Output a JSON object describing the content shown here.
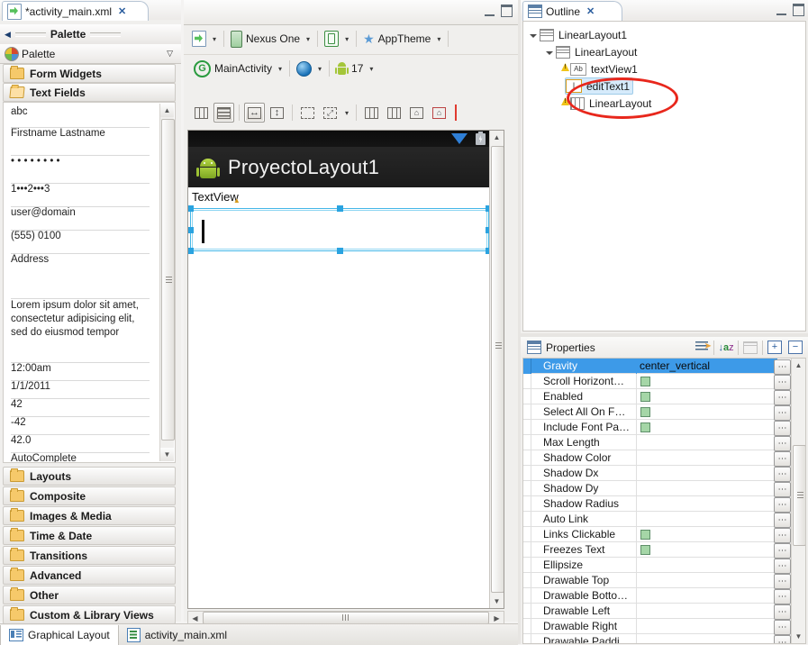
{
  "editor": {
    "tab_title": "*activity_main.xml",
    "close_glyph": "✕",
    "toolbar_row1": [
      {
        "label": "",
        "icon": "xml-config-icon",
        "caret": "▾"
      },
      {
        "label": "Nexus One",
        "icon": "device-icon",
        "caret": "▾"
      },
      {
        "label": "",
        "icon": "orientation-icon",
        "caret": "▾"
      },
      {
        "label": "AppTheme",
        "icon": "theme-star-icon",
        "caret": "▾"
      }
    ],
    "toolbar_row2": [
      {
        "label": "MainActivity",
        "icon": "activity-icon",
        "caret": "▾"
      },
      {
        "label": "",
        "icon": "locale-globe-icon",
        "caret": "▾"
      },
      {
        "label": "17",
        "icon": "android-api-icon",
        "caret": "▾"
      }
    ],
    "toolbar_row3": [
      {
        "name": "distribute-columns-button",
        "active": false
      },
      {
        "name": "distribute-rows-button",
        "active": true
      },
      {
        "name": "match-width-button",
        "active": true
      },
      {
        "name": "match-height-button",
        "active": false
      },
      {
        "name": "select-marquee-button",
        "active": false
      },
      {
        "name": "expand-all-button",
        "active": false
      },
      {
        "name": "show-included-button",
        "active": false
      },
      {
        "name": "show-outline-button",
        "active": false
      },
      {
        "name": "show-baseline-button",
        "active": false
      },
      {
        "name": "hide-baseline-button",
        "active": false
      }
    ],
    "bottom_tabs": [
      {
        "label": "Graphical Layout",
        "icon": "graphical-layout-icon",
        "active": true
      },
      {
        "label": "activity_main.xml",
        "icon": "xml-source-icon",
        "active": false
      }
    ]
  },
  "canvas": {
    "app_title": "ProyectoLayout1",
    "textview_label": "TextView",
    "status_signal": "signal-icon",
    "status_battery": "battery-icon",
    "selection_handle_color": "#2aa3e0"
  },
  "palette": {
    "header_title": "Palette",
    "strip_label": "Palette",
    "collapse_glyph": "◀",
    "chevron_glyph": "▽",
    "categories_top": [
      {
        "label": "Form Widgets",
        "open": false
      },
      {
        "label": "Text Fields",
        "open": true
      }
    ],
    "items": [
      {
        "label": "abc",
        "height": 27
      },
      {
        "label": "Firstname Lastname",
        "height": 34
      },
      {
        "label": "• • • • • • • •",
        "height": 34
      },
      {
        "label": "1•••2•••3",
        "height": 29
      },
      {
        "label": "user@domain",
        "height": 29
      },
      {
        "label": "(555) 0100",
        "height": 29
      },
      {
        "label": "Address",
        "height": 53
      },
      {
        "label": "Lorem ipsum dolor sit amet, consectetur adipisicing elit, sed do eiusmod tempor",
        "height": 74,
        "multiline": true
      },
      {
        "label": "12:00am",
        "height": 23
      },
      {
        "label": "1/1/2011",
        "height": 23
      },
      {
        "label": "42",
        "height": 23
      },
      {
        "label": "-42",
        "height": 23
      },
      {
        "label": "42.0",
        "height": 23
      },
      {
        "label": "AutoComplete",
        "height": 23
      }
    ],
    "categories_bottom": [
      {
        "label": "Layouts"
      },
      {
        "label": "Composite"
      },
      {
        "label": "Images & Media"
      },
      {
        "label": "Time & Date"
      },
      {
        "label": "Transitions"
      },
      {
        "label": "Advanced"
      },
      {
        "label": "Other"
      },
      {
        "label": "Custom & Library Views"
      }
    ]
  },
  "outline": {
    "tab_title": "Outline",
    "close_glyph": "✕",
    "nodes": [
      {
        "label": "LinearLayout1",
        "indent": 0,
        "icon": "linearlayout-icon",
        "twisty": true,
        "warn": false,
        "selected": false
      },
      {
        "label": "LinearLayout",
        "indent": 1,
        "icon": "linearlayout-icon",
        "twisty": true,
        "warn": false,
        "selected": false
      },
      {
        "label": "textView1",
        "indent": 2,
        "icon": "textview-icon",
        "twisty": false,
        "warn": true,
        "selected": false
      },
      {
        "label": "editText1",
        "indent": 2,
        "icon": "edittext-icon",
        "twisty": false,
        "warn": false,
        "selected": true
      },
      {
        "label": "LinearLayout",
        "indent": 1,
        "icon": "linearlayout-vertical-icon",
        "twisty": false,
        "warn": true,
        "selected": false
      }
    ],
    "annotation": {
      "shape": "red-ellipse",
      "color": "#e8271c"
    }
  },
  "properties": {
    "title": "Properties",
    "tools": [
      {
        "name": "show-advanced-toggle"
      },
      {
        "name": "sort-alphabetically-button"
      },
      {
        "name": "table-view-button"
      },
      {
        "name": "expand-all-button",
        "glyph": "+"
      },
      {
        "name": "collapse-all-button",
        "glyph": "−"
      }
    ],
    "rows": [
      {
        "name": "Gravity",
        "value": "center_vertical",
        "checkbox": false,
        "selected": true
      },
      {
        "name": "Scroll Horizont…",
        "value": "",
        "checkbox": true,
        "selected": false
      },
      {
        "name": "Enabled",
        "value": "",
        "checkbox": true,
        "selected": false
      },
      {
        "name": "Select All On F…",
        "value": "",
        "checkbox": true,
        "selected": false
      },
      {
        "name": "Include Font Pa…",
        "value": "",
        "checkbox": true,
        "selected": false
      },
      {
        "name": "Max Length",
        "value": "",
        "checkbox": false,
        "selected": false
      },
      {
        "name": "Shadow Color",
        "value": "",
        "checkbox": false,
        "selected": false
      },
      {
        "name": "Shadow Dx",
        "value": "",
        "checkbox": false,
        "selected": false
      },
      {
        "name": "Shadow Dy",
        "value": "",
        "checkbox": false,
        "selected": false
      },
      {
        "name": "Shadow Radius",
        "value": "",
        "checkbox": false,
        "selected": false
      },
      {
        "name": "Auto Link",
        "value": "",
        "checkbox": false,
        "selected": false
      },
      {
        "name": "Links Clickable",
        "value": "",
        "checkbox": true,
        "selected": false
      },
      {
        "name": "Freezes Text",
        "value": "",
        "checkbox": true,
        "selected": false
      },
      {
        "name": "Ellipsize",
        "value": "",
        "checkbox": false,
        "selected": false
      },
      {
        "name": "Drawable Top",
        "value": "",
        "checkbox": false,
        "selected": false
      },
      {
        "name": "Drawable Botto…",
        "value": "",
        "checkbox": false,
        "selected": false
      },
      {
        "name": "Drawable Left",
        "value": "",
        "checkbox": false,
        "selected": false
      },
      {
        "name": "Drawable Right",
        "value": "",
        "checkbox": false,
        "selected": false
      },
      {
        "name": "Drawable Paddi…",
        "value": "",
        "checkbox": false,
        "selected": false
      }
    ],
    "ellipsis_glyph": "⋯",
    "selection_color": "#3d9ae8"
  }
}
